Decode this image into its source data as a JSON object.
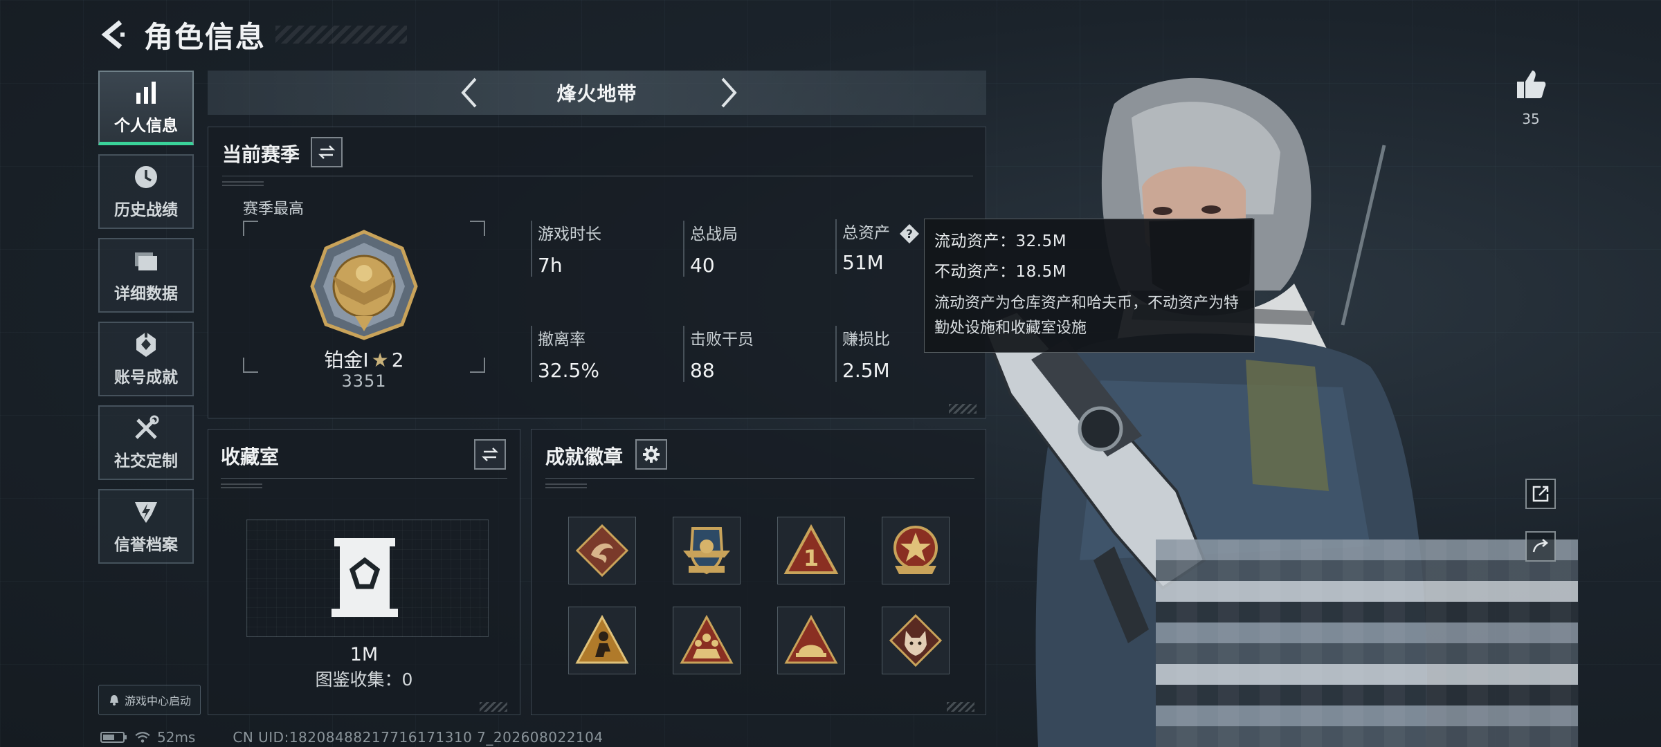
{
  "header": {
    "title": "角色信息"
  },
  "sidenav": {
    "items": [
      {
        "label": "个人信息",
        "icon": "bar-chart-icon",
        "active": true
      },
      {
        "label": "历史战绩",
        "icon": "clock-icon",
        "active": false
      },
      {
        "label": "详细数据",
        "icon": "folder-icon",
        "active": false
      },
      {
        "label": "账号成就",
        "icon": "achievement-icon",
        "active": false
      },
      {
        "label": "社交定制",
        "icon": "tools-icon",
        "active": false
      },
      {
        "label": "信誉档案",
        "icon": "credit-icon",
        "active": false
      }
    ],
    "game_center": "游戏中心启动"
  },
  "mode": {
    "name": "烽火地带"
  },
  "season": {
    "title": "当前赛季",
    "best_label": "赛季最高",
    "rank_name": "铂金I",
    "rank_stars": "2",
    "rank_score": "3351",
    "stats": [
      {
        "label": "游戏时长",
        "value": "7h"
      },
      {
        "label": "总战局",
        "value": "40"
      },
      {
        "label": "总资产",
        "value": "51M"
      },
      {
        "label": "撤离率",
        "value": "32.5%"
      },
      {
        "label": "击败干员",
        "value": "88"
      },
      {
        "label": "赚损比",
        "value": "2.5M"
      }
    ]
  },
  "tooltip": {
    "liquid": "流动资产：32.5M",
    "fixed": "不动资产：18.5M",
    "desc": "流动资产为仓库资产和哈夫币，不动资产为特勤处设施和收藏室设施"
  },
  "collection": {
    "title": "收藏室",
    "value": "1M",
    "count": "图鉴收集：0"
  },
  "badges": {
    "title": "成就徽章",
    "items": [
      "dragon-badge-icon",
      "wings-badge-icon",
      "number-one-badge-icon",
      "star-badge-icon",
      "sitting-figure-badge-icon",
      "team-badge-icon",
      "helmet-badge-icon",
      "wolf-badge-icon"
    ]
  },
  "social": {
    "likes": "35"
  },
  "status": {
    "ping": "52ms",
    "uid": "CN UID:18208488217716171310 7_202608022104"
  },
  "colors": {
    "accent": "#3ad39a",
    "gold": "#c9a35a",
    "badge_red": "#8a2f22"
  }
}
